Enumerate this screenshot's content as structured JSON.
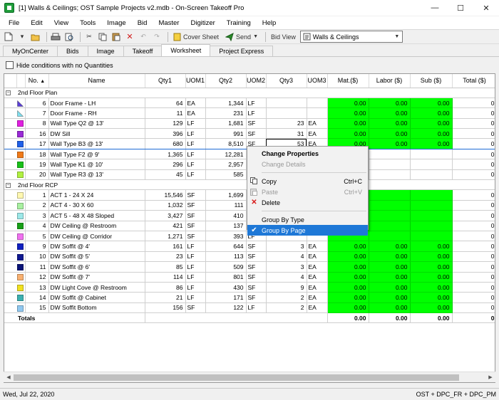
{
  "window": {
    "title": "[1] Walls & Ceilings; OST Sample Projects v2.mdb - On-Screen Takeoff Pro",
    "minimize": "—",
    "maximize": "☐",
    "close": "✕"
  },
  "menu": [
    "File",
    "Edit",
    "View",
    "Tools",
    "Image",
    "Bid",
    "Master",
    "Digitizer",
    "Training",
    "Help"
  ],
  "toolbar": {
    "cover_sheet": "Cover Sheet",
    "send": "Send",
    "bid_view_label": "Bid View",
    "bid_view_value": "Walls & Ceilings"
  },
  "tabs": [
    "MyOnCenter",
    "Bids",
    "Image",
    "Takeoff",
    "Worksheet",
    "Project Express"
  ],
  "active_tab": "Worksheet",
  "hide_conditions_label": "Hide conditions with no Quantities",
  "columns": [
    "No.",
    "Name",
    "Qty1",
    "UOM1",
    "Qty2",
    "UOM2",
    "Qty3",
    "UOM3",
    "Mat.($)",
    "Labor ($)",
    "Sub ($)",
    "Total ($)"
  ],
  "groups": [
    {
      "name": "2nd Floor Plan",
      "rows": [
        {
          "no": "6",
          "color": "#5a3fd8",
          "icon": "triangle",
          "name": "Door Frame - LH",
          "qty1": "64",
          "uom1": "EA",
          "qty2": "1,344",
          "uom2": "LF",
          "qty3": "",
          "uom3": "",
          "mat": "0.00",
          "labor": "0.00",
          "sub": "0.00",
          "total": "0"
        },
        {
          "no": "7",
          "color": "#7fe0f0",
          "icon": "triangle",
          "name": "Door Frame - RH",
          "qty1": "11",
          "uom1": "EA",
          "qty2": "231",
          "uom2": "LF",
          "qty3": "",
          "uom3": "",
          "mat": "0.00",
          "labor": "0.00",
          "sub": "0.00",
          "total": "0"
        },
        {
          "no": "8",
          "color": "#e020e0",
          "icon": "square",
          "name": "Wall Type Q2 @ 13'",
          "qty1": "129",
          "uom1": "LF",
          "qty2": "1,681",
          "uom2": "SF",
          "qty3": "23",
          "uom3": "EA",
          "mat": "0.00",
          "labor": "0.00",
          "sub": "0.00",
          "total": "0"
        },
        {
          "no": "16",
          "color": "#9a2ad6",
          "icon": "square",
          "name": "DW Sill",
          "qty1": "396",
          "uom1": "LF",
          "qty2": "991",
          "uom2": "SF",
          "qty3": "31",
          "uom3": "EA",
          "mat": "0.00",
          "labor": "0.00",
          "sub": "0.00",
          "total": "0"
        },
        {
          "no": "17",
          "color": "#2060e8",
          "icon": "square",
          "name": "Wall Type B3 @ 13'",
          "qty1": "680",
          "uom1": "LF",
          "qty2": "8,510",
          "uom2": "SF",
          "qty3": "53",
          "uom3": "EA",
          "mat": "0.00",
          "labor": "0.00",
          "sub": "0.00",
          "total": "0",
          "selected": true
        },
        {
          "no": "18",
          "color": "#f07a18",
          "icon": "square",
          "name": "Wall Type F2 @ 9'",
          "qty1": "1,365",
          "uom1": "LF",
          "qty2": "12,281",
          "uom2": "SF",
          "qty3": "",
          "uom3": "",
          "mat": "",
          "labor": "",
          "sub": "",
          "total": "0"
        },
        {
          "no": "19",
          "color": "#18c018",
          "icon": "square",
          "name": "Wall Type K1 @ 10'",
          "qty1": "296",
          "uom1": "LF",
          "qty2": "2,957",
          "uom2": "SF",
          "qty3": "",
          "uom3": "",
          "mat": "",
          "labor": "",
          "sub": "",
          "total": "0"
        },
        {
          "no": "20",
          "color": "#b0f040",
          "icon": "square",
          "name": "Wall Type R3 @ 13'",
          "qty1": "45",
          "uom1": "LF",
          "qty2": "585",
          "uom2": "SF",
          "qty3": "",
          "uom3": "",
          "mat": "",
          "labor": "",
          "sub": "",
          "total": "0"
        }
      ]
    },
    {
      "name": "2nd Floor RCP",
      "rows": [
        {
          "no": "1",
          "color": "#fff8b0",
          "icon": "square",
          "name": "ACT 1 - 24 X 24",
          "qty1": "15,546",
          "uom1": "SF",
          "qty2": "1,699",
          "uom2": "LF",
          "qty3": "",
          "uom3": "",
          "mat": "",
          "labor": "",
          "sub": "",
          "total": "0"
        },
        {
          "no": "2",
          "color": "#a8f0a0",
          "icon": "square",
          "name": "ACT 4 - 30 X 60",
          "qty1": "1,032",
          "uom1": "SF",
          "qty2": "111",
          "uom2": "LF",
          "qty3": "",
          "uom3": "",
          "mat": "",
          "labor": "",
          "sub": "",
          "total": "0"
        },
        {
          "no": "3",
          "color": "#9ce8e8",
          "icon": "square",
          "name": "ACT 5 - 48 X 48 Sloped",
          "qty1": "3,427",
          "uom1": "SF",
          "qty2": "410",
          "uom2": "LF",
          "qty3": "",
          "uom3": "",
          "mat": "",
          "labor": "",
          "sub": "",
          "total": "0"
        },
        {
          "no": "4",
          "color": "#18a018",
          "icon": "square",
          "name": "DW Ceiling @ Restroom",
          "qty1": "421",
          "uom1": "SF",
          "qty2": "137",
          "uom2": "LF",
          "qty3": "",
          "uom3": "",
          "mat": "",
          "labor": "",
          "sub": "",
          "total": "0"
        },
        {
          "no": "5",
          "color": "#f070f0",
          "icon": "square",
          "name": "DW Ceiling @ Corridor",
          "qty1": "1,271",
          "uom1": "SF",
          "qty2": "393",
          "uom2": "LF",
          "qty3": "",
          "uom3": "",
          "mat": "",
          "labor": "",
          "sub": "",
          "total": "0"
        },
        {
          "no": "9",
          "color": "#1020c0",
          "icon": "square",
          "name": "DW Soffit @ 4'",
          "qty1": "161",
          "uom1": "LF",
          "qty2": "644",
          "uom2": "SF",
          "qty3": "3",
          "uom3": "EA",
          "mat": "0.00",
          "labor": "0.00",
          "sub": "0.00",
          "total": "0"
        },
        {
          "no": "10",
          "color": "#101890",
          "icon": "square",
          "name": "DW Soffit @ 5'",
          "qty1": "23",
          "uom1": "LF",
          "qty2": "113",
          "uom2": "SF",
          "qty3": "4",
          "uom3": "EA",
          "mat": "0.00",
          "labor": "0.00",
          "sub": "0.00",
          "total": "0"
        },
        {
          "no": "11",
          "color": "#0a1478",
          "icon": "square",
          "name": "DW Soffit @ 6'",
          "qty1": "85",
          "uom1": "LF",
          "qty2": "509",
          "uom2": "SF",
          "qty3": "3",
          "uom3": "EA",
          "mat": "0.00",
          "labor": "0.00",
          "sub": "0.00",
          "total": "0"
        },
        {
          "no": "12",
          "color": "#f8b070",
          "icon": "square",
          "name": "DW Soffit @ 7'",
          "qty1": "114",
          "uom1": "LF",
          "qty2": "801",
          "uom2": "SF",
          "qty3": "4",
          "uom3": "EA",
          "mat": "0.00",
          "labor": "0.00",
          "sub": "0.00",
          "total": "0"
        },
        {
          "no": "13",
          "color": "#f0e020",
          "icon": "square",
          "name": "DW Light Cove @ Restroom",
          "qty1": "86",
          "uom1": "LF",
          "qty2": "430",
          "uom2": "SF",
          "qty3": "9",
          "uom3": "EA",
          "mat": "0.00",
          "labor": "0.00",
          "sub": "0.00",
          "total": "0"
        },
        {
          "no": "14",
          "color": "#3cb0b0",
          "icon": "square",
          "name": "DW Soffit @ Cabinet",
          "qty1": "21",
          "uom1": "LF",
          "qty2": "171",
          "uom2": "SF",
          "qty3": "2",
          "uom3": "EA",
          "mat": "0.00",
          "labor": "0.00",
          "sub": "0.00",
          "total": "0"
        },
        {
          "no": "15",
          "color": "#90c8f0",
          "icon": "square",
          "name": "DW Soffit Bottom",
          "qty1": "156",
          "uom1": "SF",
          "qty2": "122",
          "uom2": "LF",
          "qty3": "2",
          "uom3": "EA",
          "mat": "0.00",
          "labor": "0.00",
          "sub": "0.00",
          "total": "0"
        }
      ]
    }
  ],
  "totals": {
    "label": "Totals",
    "mat": "0.00",
    "labor": "0.00",
    "sub": "0.00",
    "total": "0"
  },
  "context_menu": {
    "change_properties": "Change Properties",
    "change_details": "Change Details",
    "copy": "Copy",
    "copy_shortcut": "Ctrl+C",
    "paste": "Paste",
    "paste_shortcut": "Ctrl+V",
    "delete": "Delete",
    "group_by_type": "Group By Type",
    "group_by_page": "Group By Page"
  },
  "status": {
    "date": "Wed, Jul 22, 2020",
    "right": "OST + DPC_FR + DPC_PM"
  },
  "colors": {
    "cost_fill": "#00ff00",
    "selection": "#1e78d7"
  }
}
